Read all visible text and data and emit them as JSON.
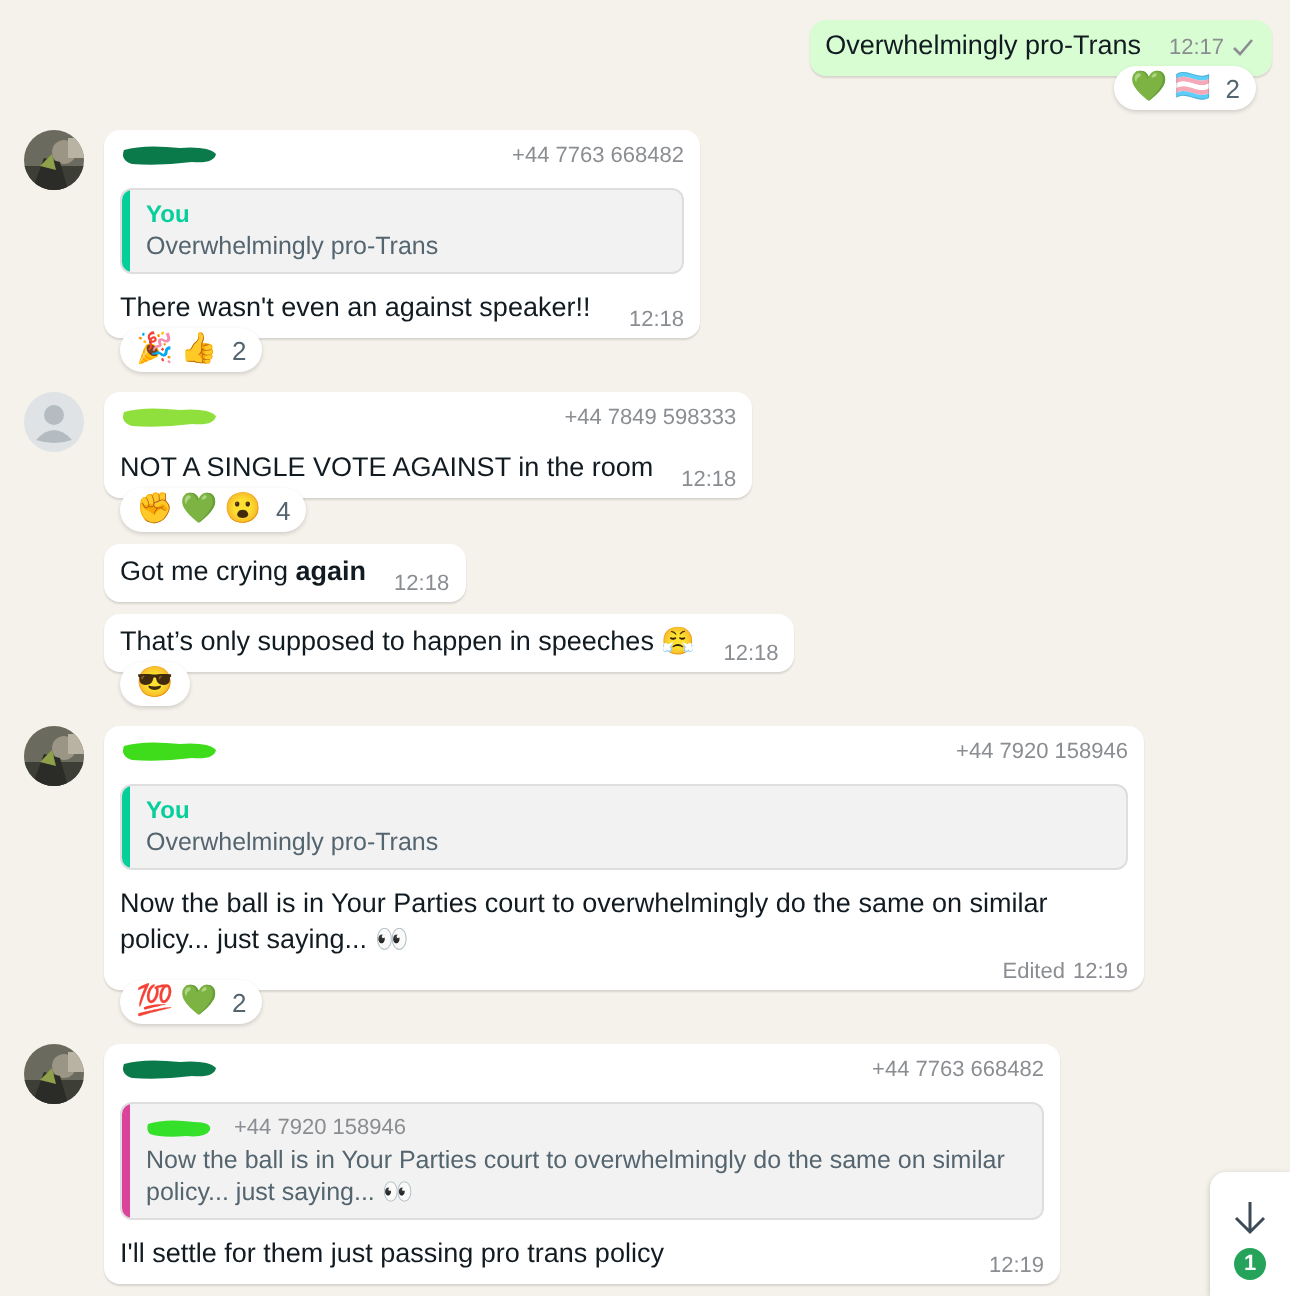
{
  "messages": [
    {
      "kind": "outgoing",
      "text": "Overwhelmingly pro-Trans",
      "time": "12:17",
      "read": false,
      "reactions": {
        "emojis": [
          "💚",
          "🏳️‍⚧️"
        ],
        "count": "2"
      }
    },
    {
      "kind": "incoming",
      "has_photo": true,
      "sender": {
        "color": "#0b7a4b",
        "phone": "+44 7763 668482"
      },
      "quote": {
        "author": "You",
        "color": "#06cf9c",
        "text": "Overwhelmingly pro-Trans"
      },
      "text": "There wasn't even an against speaker!!",
      "time": "12:18",
      "reactions": {
        "emojis": [
          "🎉",
          "👍"
        ],
        "count": "2"
      }
    },
    {
      "kind": "incoming",
      "has_photo": false,
      "sender": {
        "color": "#8fe03c",
        "phone": "+44 7849 598333"
      },
      "text": "NOT A SINGLE VOTE AGAINST in the room",
      "time": "12:18",
      "reactions": {
        "emojis": [
          "✊",
          "💚",
          "😮"
        ],
        "count": "4"
      }
    },
    {
      "kind": "incoming",
      "text": "Got me crying **again**",
      "time": "12:18"
    },
    {
      "kind": "incoming",
      "text": "That’s only supposed to happen in speeches 😤",
      "time": "12:18",
      "reactions": {
        "emojis": [
          "😎"
        ]
      }
    },
    {
      "kind": "incoming",
      "has_photo": true,
      "sender": {
        "color": "#3fdc1c",
        "phone": "+44 7920 158946"
      },
      "quote": {
        "author": "You",
        "color": "#06cf9c",
        "text": "Overwhelmingly pro-Trans"
      },
      "text": "Now the ball is in Your Parties court to overwhelmingly do the same on similar policy... just saying... 👀",
      "edited": "Edited",
      "time": "12:19",
      "reactions": {
        "emojis": [
          "💯",
          "💚"
        ],
        "count": "2"
      }
    },
    {
      "kind": "incoming",
      "has_photo": true,
      "sender": {
        "color": "#0b7a4b",
        "phone": "+44 7763 668482"
      },
      "quote": {
        "sender": {
          "color": "#35e02a",
          "phone": "+44 7920 158946"
        },
        "color": "#d9439c",
        "text": "Now the ball is in Your Parties court to overwhelmingly do the same on similar policy... just saying... 👀"
      },
      "text": "I'll settle for them just passing pro trans policy",
      "time": "12:19"
    }
  ],
  "scroll_button": {
    "unread": "1"
  }
}
